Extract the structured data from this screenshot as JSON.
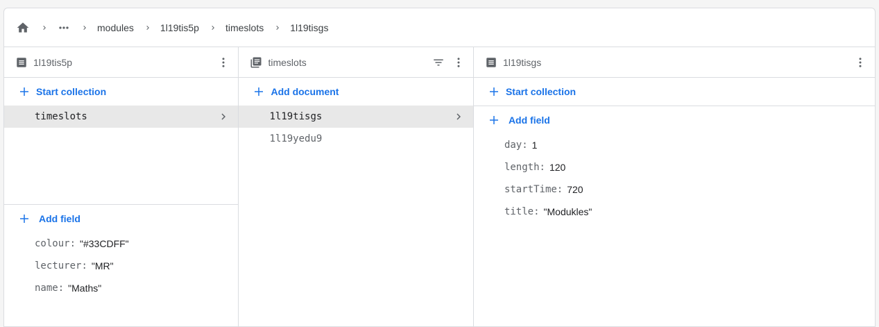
{
  "breadcrumb": {
    "items": [
      "modules",
      "1l19tis5p",
      "timeslots",
      "1l19tisgs"
    ]
  },
  "col1": {
    "header_title": "1l19tis5p",
    "start_collection": "Start collection",
    "collections": [
      "timeslots"
    ],
    "add_field": "Add field",
    "fields": [
      {
        "key": "colour",
        "value": "\"#33CDFF\""
      },
      {
        "key": "lecturer",
        "value": "\"MR\""
      },
      {
        "key": "name",
        "value": "\"Maths\""
      }
    ]
  },
  "col2": {
    "header_title": "timeslots",
    "add_document": "Add document",
    "documents": [
      "1l19tisgs",
      "1l19yedu9"
    ]
  },
  "col3": {
    "header_title": "1l19tisgs",
    "start_collection": "Start collection",
    "add_field": "Add field",
    "fields": [
      {
        "key": "day",
        "value": "1"
      },
      {
        "key": "length",
        "value": "120"
      },
      {
        "key": "startTime",
        "value": "720"
      },
      {
        "key": "title",
        "value": "\"Modukles\""
      }
    ]
  },
  "colors": {
    "accent": "#1a73e8",
    "selected_row": "#e8e8e8",
    "border": "#dadce0"
  },
  "icons": {
    "home": "home-icon",
    "more": "more-horiz-icon",
    "document": "document-icon",
    "collection": "collection-icon",
    "filter": "filter-icon",
    "kebab": "more-vert-icon",
    "chevron": "chevron-right-icon",
    "add": "add-icon"
  }
}
